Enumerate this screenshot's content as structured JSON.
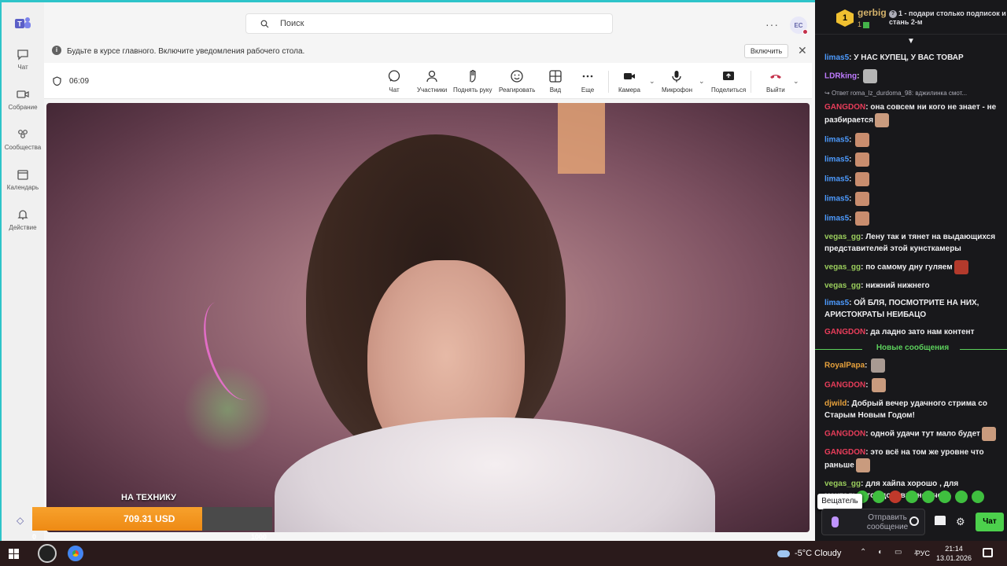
{
  "teams": {
    "search_placeholder": "Поиск",
    "avatar_initials": "EC",
    "rail": [
      {
        "label": "Чат",
        "icon": "chat-icon"
      },
      {
        "label": "Собрание",
        "icon": "video-icon"
      },
      {
        "label": "Сообщества",
        "icon": "communities-icon"
      },
      {
        "label": "Календарь",
        "icon": "calendar-icon"
      },
      {
        "label": "Действие",
        "icon": "bell-icon"
      }
    ],
    "notification": {
      "message": "Будьте в курсе главного. Включите уведомления рабочего стола.",
      "enable_label": "Включить",
      "close": "✕"
    },
    "call": {
      "timer": "06:09",
      "buttons": {
        "chat": "Чат",
        "participants": "Участники",
        "raise_hand": "Поднять руку",
        "react": "Реагировать",
        "view": "Вид",
        "more": "Еще",
        "camera": "Камера",
        "mic": "Микрофон",
        "share": "Поделиться",
        "leave": "Выйти"
      }
    }
  },
  "donation": {
    "label": "НА ТЕХНИКУ",
    "amount": "709.31 USD",
    "goal_min": "0",
    "goal_max": "1000",
    "progress": 0.709
  },
  "chat": {
    "top_gifter": {
      "rank": "1",
      "name": "gerbig",
      "count": "1",
      "message": "1 - подари столько подписок и стань 2-м"
    },
    "new_messages_label": "Новые сообщения",
    "messages": [
      {
        "user": "limas5",
        "color": "#4d9bff",
        "text": "У НАС КУПЕЦ, У ВАС ТОВАР"
      },
      {
        "user": "LDRking",
        "color": "#bf7bff",
        "text": "",
        "emote": "#b5b5b5"
      },
      {
        "reply": "Ответ roma_lz_durdoma_98: вджилинка смот..."
      },
      {
        "user": "GANGDON",
        "color": "#e83d5a",
        "text": "она совсем ни кого не знает - не разбирается",
        "emote": "#c99b7e"
      },
      {
        "user": "limas5",
        "color": "#4d9bff",
        "text": "",
        "emote": "#c98d6e"
      },
      {
        "user": "limas5",
        "color": "#4d9bff",
        "text": "",
        "emote": "#c98d6e"
      },
      {
        "user": "limas5",
        "color": "#4d9bff",
        "text": "",
        "emote": "#c98d6e"
      },
      {
        "user": "limas5",
        "color": "#4d9bff",
        "text": "",
        "emote": "#c98d6e"
      },
      {
        "user": "limas5",
        "color": "#4d9bff",
        "text": "",
        "emote": "#c98d6e"
      },
      {
        "user": "vegas_gg",
        "color": "#9acd5c",
        "text": "Лену так и тянет на выдающихся представителей этой кунсткамеры"
      },
      {
        "user": "vegas_gg",
        "color": "#9acd5c",
        "text": "по самому дну гуляем",
        "emote": "#b33a2c"
      },
      {
        "user": "vegas_gg",
        "color": "#9acd5c",
        "text": "нижний нижнего"
      },
      {
        "user": "limas5",
        "color": "#4d9bff",
        "text": "ОЙ БЛЯ, ПОСМОТРИТЕ НА НИХ, АРИСТОКРАТЫ НЕИБАЦО"
      },
      {
        "user": "GANGDON",
        "color": "#e83d5a",
        "text": "да ладно зато нам контент"
      }
    ],
    "new_messages": [
      {
        "user": "RoyalPapa",
        "color": "#e8a23c",
        "text": "",
        "emote": "#a89a92"
      },
      {
        "user": "GANGDON",
        "color": "#e83d5a",
        "text": "",
        "emote": "#c99b7e"
      },
      {
        "user": "djwild",
        "color": "#e8a23c",
        "text": "Добрый вечер удачного стрима со Старым Новым Годом!"
      },
      {
        "user": "GANGDON",
        "color": "#e83d5a",
        "text": "одной удачи тут мало будет",
        "emote": "#c99b7e"
      },
      {
        "user": "GANGDON",
        "color": "#e83d5a",
        "text": "это всё на том же уровне что раньше",
        "emote": "#c99b7e"
      },
      {
        "user": "vegas_gg",
        "color": "#9acd5c",
        "text": "для хайпа хорошо , для ментального здоровья не очень"
      }
    ],
    "tooltip": "Вещатель",
    "input_placeholder": "Отправить сообщение",
    "chat_button": "Чат"
  },
  "taskbar": {
    "weather": "-5°C  Cloudy",
    "lang": "РУС",
    "time": "21:14",
    "date": "13.01.2026"
  }
}
